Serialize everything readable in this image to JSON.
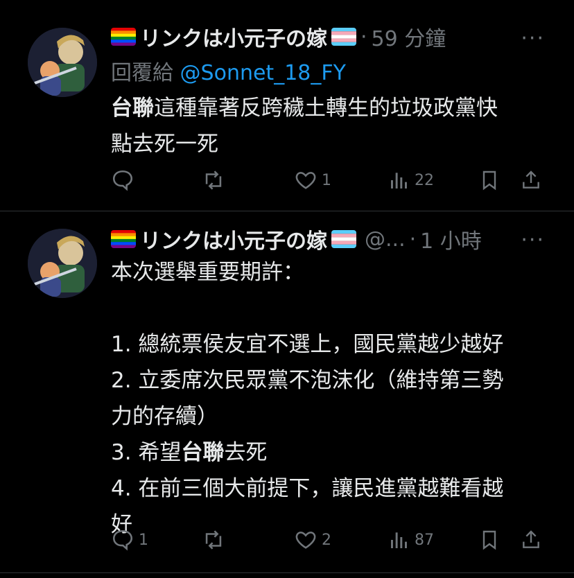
{
  "tweets": [
    {
      "display_name": "リンクは小元子の嫁",
      "handle": "",
      "time": "59 分鐘",
      "reply_prefix": "回覆給",
      "reply_mention": "@Sonnet_18_FY",
      "body_lines": [
        {
          "bold": "台聯",
          "text": "這種靠著反跨穢土轉生的垃圾政黨快"
        },
        {
          "bold": "",
          "text": "點去死一死"
        }
      ],
      "stats": {
        "replies": "",
        "retweets": "",
        "likes": "1",
        "views": "22"
      }
    },
    {
      "display_name": "リンクは小元子の嫁",
      "handle": "@...",
      "time": "1 小時",
      "body_lines": [
        {
          "bold": "",
          "text": "本次選舉重要期許："
        },
        {
          "bold": "",
          "text": ""
        },
        {
          "bold": "",
          "text": "1. 總統票侯友宜不選上，國民黨越少越好"
        },
        {
          "bold": "",
          "text": "2. 立委席次民眾黨不泡沫化（維持第三勢"
        },
        {
          "bold": "",
          "text": "力的存續）"
        },
        {
          "pre": "3. 希望",
          "bold": "台聯",
          "text": "去死"
        },
        {
          "bold": "",
          "text": "4. 在前三個大前提下，讓民進黨越難看越"
        },
        {
          "bold": "",
          "text": "好"
        }
      ],
      "stats": {
        "replies": "1",
        "retweets": "",
        "likes": "2",
        "views": "87"
      }
    }
  ],
  "more_label": "···",
  "dot": "·",
  "icons": [
    "reply-icon",
    "retweet-icon",
    "like-icon",
    "views-icon",
    "bookmark-icon",
    "share-icon",
    "rainbow-flag-icon",
    "trans-flag-icon"
  ],
  "colors": {
    "background": "#000000",
    "text": "#e7e9ea",
    "muted": "#71767b",
    "link": "#1d9bf0",
    "divider": "#2f3336"
  }
}
